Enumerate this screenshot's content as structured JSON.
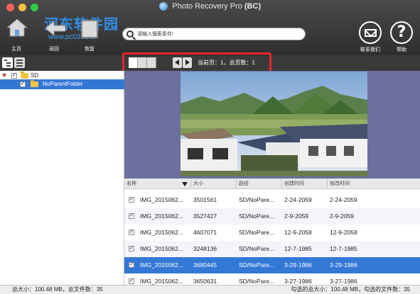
{
  "window": {
    "title": "Photo Recovery Pro",
    "title_suffix": "(BC)"
  },
  "watermark": {
    "text": "河东软件园",
    "url": "www.pc0359.cn"
  },
  "toolbar": {
    "home_label": "主页",
    "back_label": "返回",
    "restore_label": "恢复",
    "contact_label": "联系我们",
    "help_label": "帮助",
    "help_glyph": "?"
  },
  "search": {
    "placeholder": "请输入搜索条件!"
  },
  "pager": {
    "info": "当前页：1，总页数：1"
  },
  "tree": {
    "root_label": "SD",
    "child_label": "NoParentFolder"
  },
  "table": {
    "headers": [
      "名称",
      "大小",
      "路径",
      "创建时间",
      "修改时间"
    ],
    "rows": [
      {
        "name": "IMG_2015062...",
        "size": "3501561",
        "path": "SD/NoPare...",
        "created": "2-24-2059",
        "modified": "2-24-2059",
        "checked": true
      },
      {
        "name": "IMG_2015062...",
        "size": "3527427",
        "path": "SD/NoPare...",
        "created": "2-9-2059",
        "modified": "2-9-2059",
        "checked": true
      },
      {
        "name": "IMG_2015062...",
        "size": "4607071",
        "path": "SD/NoPare...",
        "created": "12-9-2058",
        "modified": "12-9-2058",
        "checked": true
      },
      {
        "name": "IMG_2015062...",
        "size": "3248136",
        "path": "SD/NoPare...",
        "created": "12-7-1985",
        "modified": "12-7-1985",
        "checked": true
      },
      {
        "name": "IMG_2015062...",
        "size": "3680445",
        "path": "SD/NoPare...",
        "created": "3-29-1986",
        "modified": "3-29-1986",
        "checked": true
      },
      {
        "name": "IMG_2015062...",
        "size": "3650631",
        "path": "SD/NoPare...",
        "created": "3-27-1986",
        "modified": "3-27-1986",
        "checked": true
      }
    ],
    "selected_row": 4
  },
  "status": {
    "left": "总大小：100.48 MB，总文件数：35",
    "right": "勾选的总大小：100.48 MB，勾选的文件数：35"
  },
  "colors": {
    "selection": "#3478d6",
    "highlight_box": "#e4262b",
    "preview_bg": "#6d6f9e"
  }
}
